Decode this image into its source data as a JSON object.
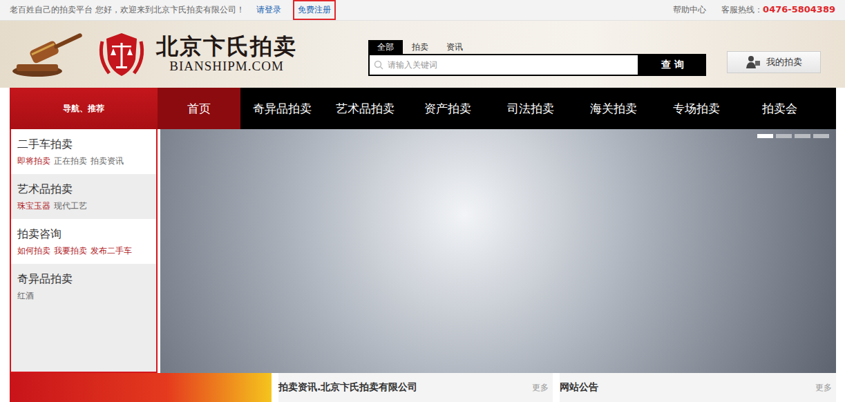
{
  "top_bar": {
    "welcome": "老百姓自己的拍卖平台 您好，欢迎来到北京卞氏拍卖有限公司！",
    "login": "请登录",
    "register": {
      "label": "免费注册",
      "outlined": true
    },
    "help": "帮助中心",
    "hotline_label": "客服热线：",
    "hotline": "0476-5804389"
  },
  "logo": {
    "name": "北京卞氏拍卖",
    "domain": "BIANSHIPM.COM"
  },
  "search": {
    "tabs": [
      {
        "label": "全部",
        "selected": true
      },
      {
        "label": "拍卖",
        "selected": false
      },
      {
        "label": "资讯",
        "selected": false
      }
    ],
    "placeholder": "请输入关键词",
    "button": "查 询"
  },
  "my_auction": "我的拍卖",
  "nav": {
    "title": "导航、推荐",
    "items": [
      {
        "label": "首页",
        "selected": true
      },
      {
        "label": "奇异品拍卖",
        "selected": false
      },
      {
        "label": "艺术品拍卖",
        "selected": false
      },
      {
        "label": "资产拍卖",
        "selected": false
      },
      {
        "label": "司法拍卖",
        "selected": false
      },
      {
        "label": "海关拍卖",
        "selected": false
      },
      {
        "label": "专场拍卖",
        "selected": false
      },
      {
        "label": "拍卖会",
        "selected": false
      }
    ]
  },
  "sidebar": [
    {
      "title": "二手车拍卖",
      "links": [
        {
          "label": "即将拍卖",
          "highlight": true
        },
        {
          "label": "正在拍卖",
          "highlight": false
        },
        {
          "label": "拍卖资讯",
          "highlight": false
        }
      ]
    },
    {
      "title": "艺术品拍卖",
      "links": [
        {
          "label": "珠宝玉器",
          "highlight": true
        },
        {
          "label": "现代工艺",
          "highlight": false
        }
      ]
    },
    {
      "title": "拍卖咨询",
      "links": [
        {
          "label": "如何拍卖",
          "highlight": true
        },
        {
          "label": "我要拍卖",
          "highlight": true
        },
        {
          "label": "发布二手车",
          "highlight": true
        }
      ]
    },
    {
      "title": "奇异品拍卖",
      "links": [
        {
          "label": "红酒",
          "highlight": false
        }
      ]
    }
  ],
  "banner": {
    "slides": [
      {
        "selected": true
      },
      {
        "selected": false
      },
      {
        "selected": false
      },
      {
        "selected": false
      }
    ]
  },
  "panels": [
    {
      "title": "拍卖资讯.北京卞氏拍卖有限公司",
      "more": "更多"
    },
    {
      "title": "网站公告",
      "more": "更多"
    }
  ]
}
